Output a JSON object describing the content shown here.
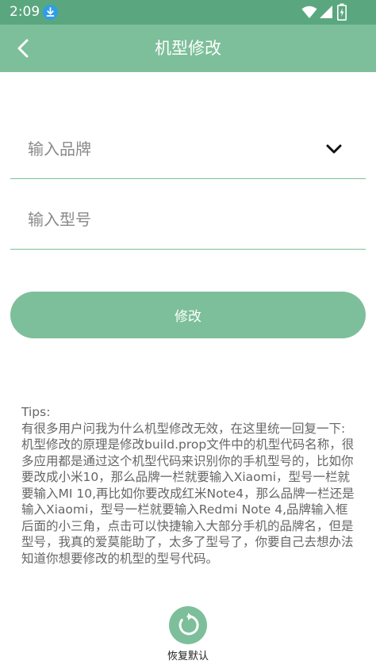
{
  "status_bar": {
    "time": "2:09",
    "icons": [
      "download-icon",
      "wifi-icon",
      "signal-icon",
      "battery-icon"
    ]
  },
  "toolbar": {
    "title": "机型修改",
    "back_icon": "back-arrow-icon"
  },
  "form": {
    "brand_placeholder": "输入品牌",
    "brand_value": "",
    "brand_dropdown_icon": "chevron-down-icon",
    "model_placeholder": "输入型号",
    "model_value": "",
    "submit_label": "修改"
  },
  "tips": {
    "heading": "Tips:",
    "body": "有很多用户问我为什么机型修改无效，在这里统一回复一下:\n机型修改的原理是修改build.prop文件中的机型代码名称，很多应用都是通过这个机型代码来识别你的手机型号的，比如你要改成小米10，那么品牌一栏就要输入Xiaomi，型号一栏就要输入MI 10,再比如你要改成红米Note4，那么品牌一栏还是输入Xiaomi，型号一栏就要输入Redmi Note 4,品牌输入框后面的小三角，点击可以快捷输入大部分手机的品牌名，但是型号，我真的爱莫能助了，太多了型号了，你要自己去想办法知道你想要修改的机型的型号代码。"
  },
  "restore": {
    "label": "恢复默认",
    "icon": "restore-icon"
  },
  "colors": {
    "status_bar": "#5aa77f",
    "accent": "#7dbf9a",
    "download_badge": "#2f9ee8",
    "tips_text": "#666666"
  }
}
